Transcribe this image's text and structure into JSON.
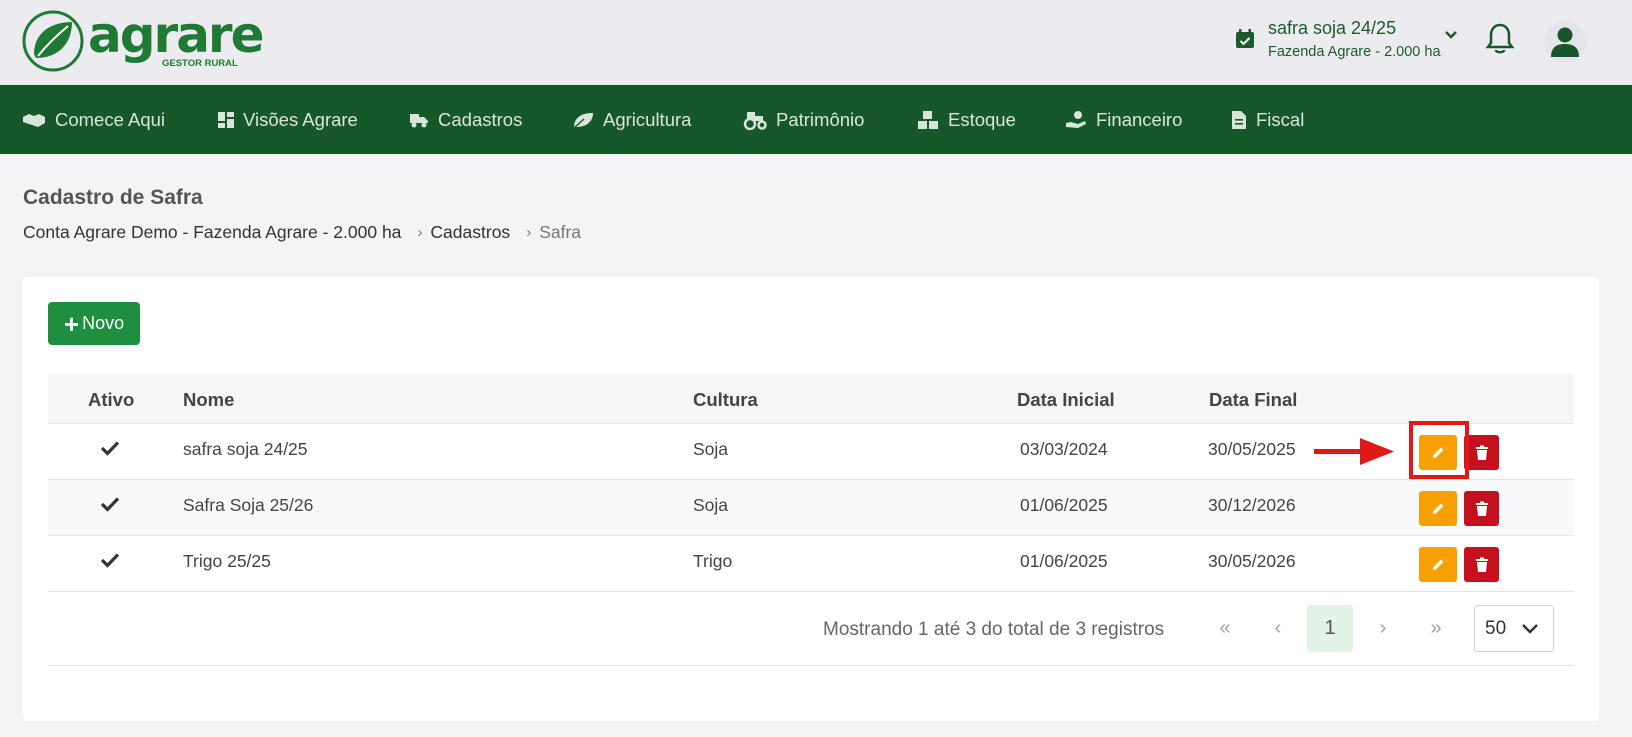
{
  "brand": {
    "name": "agrare",
    "subtitle": "GESTOR RURAL",
    "color": "#1f7a35"
  },
  "season": {
    "name": "safra soja 24/25",
    "farm": "Fazenda Agrare - 2.000 ha"
  },
  "nav": {
    "items": [
      {
        "label": "Comece Aqui",
        "icon": "handshake-icon"
      },
      {
        "label": "Visões Agrare",
        "icon": "dashboard-icon"
      },
      {
        "label": "Cadastros",
        "icon": "truck-icon"
      },
      {
        "label": "Agricultura",
        "icon": "leaf-icon"
      },
      {
        "label": "Patrimônio",
        "icon": "tractor-icon"
      },
      {
        "label": "Estoque",
        "icon": "boxes-icon"
      },
      {
        "label": "Financeiro",
        "icon": "money-hand-icon"
      },
      {
        "label": "Fiscal",
        "icon": "invoice-icon"
      }
    ],
    "background": "#17582a"
  },
  "page": {
    "title": "Cadastro de Safra",
    "breadcrumb": {
      "account": "Conta Agrare Demo - Fazenda Agrare - 2.000 ha",
      "section": "Cadastros",
      "current": "Safra"
    }
  },
  "toolbar": {
    "new_label": "Novo"
  },
  "table": {
    "headers": {
      "ativo": "Ativo",
      "nome": "Nome",
      "cultura": "Cultura",
      "data_inicial": "Data Inicial",
      "data_final": "Data Final"
    },
    "rows": [
      {
        "ativo": true,
        "nome": "safra soja 24/25",
        "cultura": "Soja",
        "data_inicial": "03/03/2024",
        "data_final": "30/05/2025"
      },
      {
        "ativo": true,
        "nome": "Safra Soja 25/26",
        "cultura": "Soja",
        "data_inicial": "01/06/2025",
        "data_final": "30/12/2026"
      },
      {
        "ativo": true,
        "nome": "Trigo 25/25",
        "cultura": "Trigo",
        "data_inicial": "01/06/2025",
        "data_final": "30/05/2026"
      }
    ]
  },
  "pagination": {
    "info": "Mostrando 1 até 3 do total de 3 registros",
    "current_page": "1",
    "first": "«",
    "prev": "‹",
    "next": "›",
    "last": "»",
    "per_page": "50"
  },
  "colors": {
    "edit": "#f8a000",
    "delete": "#c4111d",
    "primary": "#1e8f3e",
    "annotation": "#e01818"
  }
}
